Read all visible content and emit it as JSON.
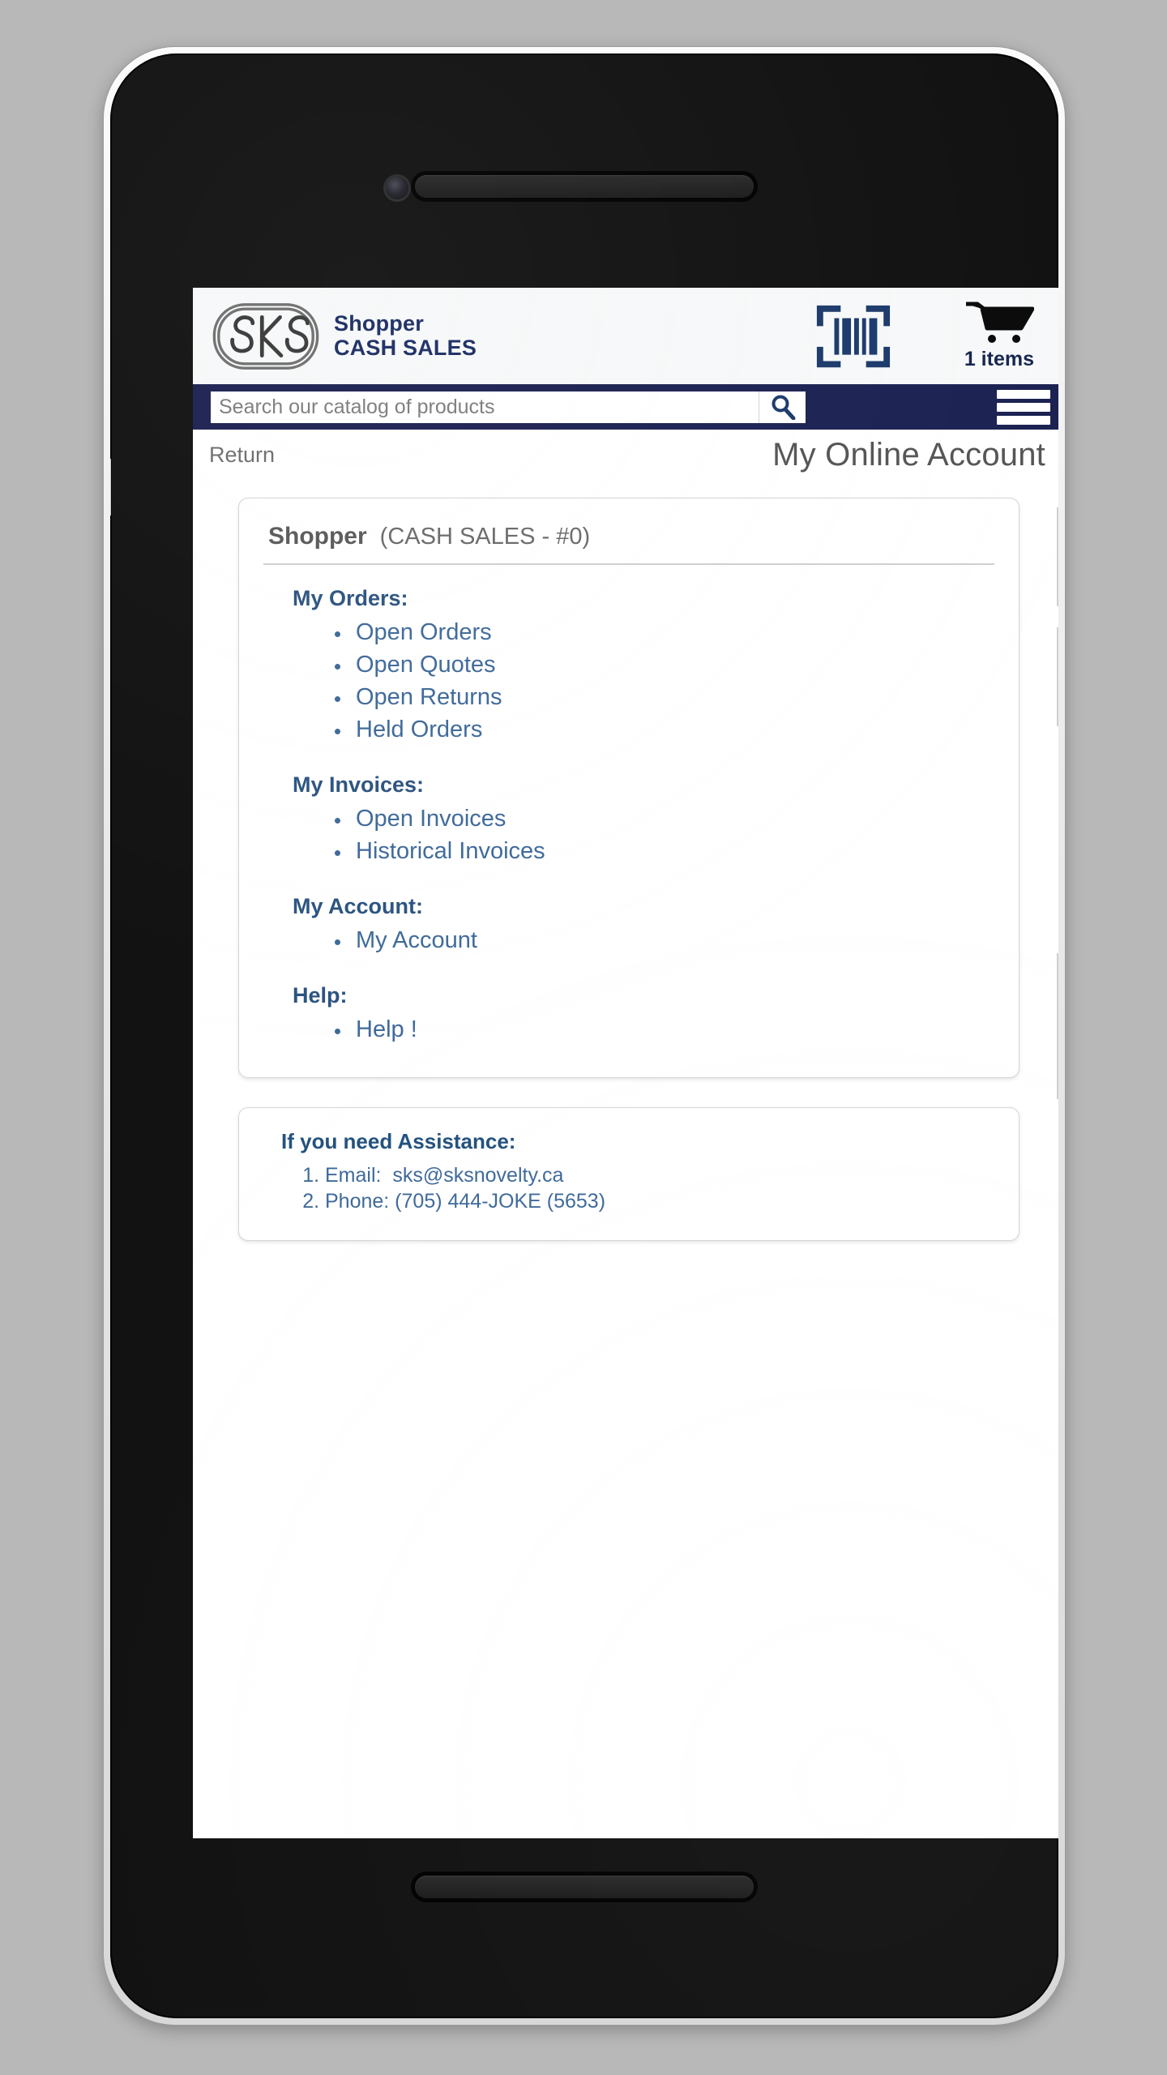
{
  "header": {
    "logo_alt": "SKS",
    "brand_line_1": "Shopper",
    "brand_line_2": "CASH SALES",
    "barcode_icon": "barcode-scan-icon",
    "cart_icon": "shopping-cart-icon",
    "cart_count_label": "1 items"
  },
  "search": {
    "placeholder": "Search our catalog of products",
    "value": "",
    "search_icon": "magnifying-glass-icon",
    "menu_icon": "hamburger-menu-icon"
  },
  "title_row": {
    "return_label": "Return",
    "page_title": "My Online Account"
  },
  "account_panel": {
    "account_name": "Shopper",
    "account_meta": "(CASH SALES - #0)",
    "sections": [
      {
        "title": "My Orders:",
        "items": [
          "Open Orders",
          "Open Quotes",
          "Open Returns",
          "Held Orders"
        ]
      },
      {
        "title": "My Invoices:",
        "items": [
          "Open Invoices",
          "Historical Invoices"
        ]
      },
      {
        "title": "My Account:",
        "items": [
          "My Account"
        ]
      },
      {
        "title": "Help:",
        "items": [
          "Help !"
        ]
      }
    ]
  },
  "assistance_panel": {
    "title": "If you need Assistance:",
    "items": [
      "Email:  sks@sksnovelty.ca",
      "Phone: (705) 444-JOKE (5653)"
    ]
  },
  "colors": {
    "navy": "#1c2252",
    "brand_navy": "#1c2d63",
    "link_blue": "#3f6a9a",
    "section_blue": "#2d5480",
    "header_bg": "#f7f8f9",
    "page_bg": "#b8b8b8"
  }
}
